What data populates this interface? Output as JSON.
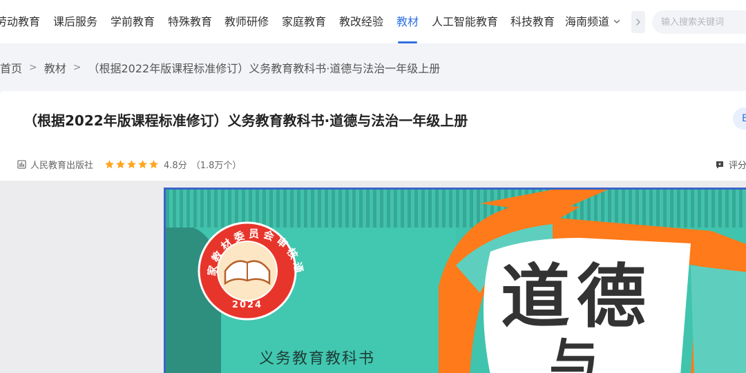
{
  "nav": {
    "items": [
      {
        "label": "劳动教育",
        "active": false
      },
      {
        "label": "课后服务",
        "active": false
      },
      {
        "label": "学前教育",
        "active": false
      },
      {
        "label": "特殊教育",
        "active": false
      },
      {
        "label": "教师研修",
        "active": false
      },
      {
        "label": "家庭教育",
        "active": false
      },
      {
        "label": "教改经验",
        "active": false
      },
      {
        "label": "教材",
        "active": true
      },
      {
        "label": "人工智能教育",
        "active": false
      },
      {
        "label": "科技教育",
        "active": false
      },
      {
        "label": "海南频道",
        "active": false
      }
    ],
    "more_icon": "chevron-down-icon",
    "next_icon": "chevron-right-icon",
    "accent_color": "#2f6fe4"
  },
  "search": {
    "placeholder": "输入搜索关键词",
    "value": ""
  },
  "breadcrumb": {
    "home": "首页",
    "category": "教材",
    "current": "（根据2022年版课程标准修订）义务教育教科书·道德与法治一年级上册",
    "separator": ">"
  },
  "book": {
    "title": "（根据2022年版课程标准修订）义务教育教科书·道德与法治一年级上册",
    "publisher": "人民教育出版社",
    "rating_stars": 5,
    "rating_score": "4.8分",
    "rating_count": "（1.8万个）",
    "rate_label": "评分",
    "action_label": "E"
  },
  "cover": {
    "seal_text": "国家教材委员会审核通过",
    "seal_year": "2024",
    "series_label": "义务教育教科书",
    "title_chars": [
      "道",
      "德",
      "与"
    ],
    "colors": {
      "teal": "#3fbfa9",
      "dark_teal": "#2e8f7f",
      "orange": "#ff7a1a",
      "seal_red": "#e8352b",
      "frame_blue": "#3a62c9"
    }
  }
}
